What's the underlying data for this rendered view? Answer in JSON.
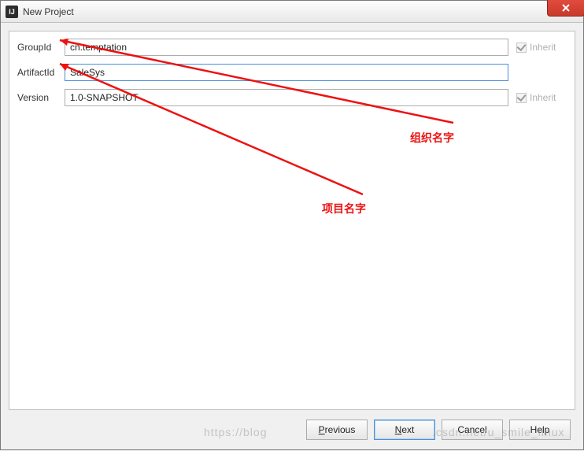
{
  "window": {
    "title": "New Project",
    "app_icon_text": "IJ"
  },
  "form": {
    "groupid_label": "GroupId",
    "groupid_value": "cn.temptation",
    "artifactid_label": "ArtifactId",
    "artifactid_value": "SaleSys",
    "version_label": "Version",
    "version_value": "1.0-SNAPSHOT",
    "inherit_label": "Inherit"
  },
  "buttons": {
    "previous": "Previous",
    "previous_mn": "P",
    "next": "Next",
    "next_mn": "N",
    "cancel": "Cancel",
    "help": "Help"
  },
  "annotations": {
    "org_name": "组织名字",
    "project_name": "项目名字"
  },
  "watermark": {
    "left": "https://blog",
    "right": ".csdn.net/u_smile_linux"
  }
}
